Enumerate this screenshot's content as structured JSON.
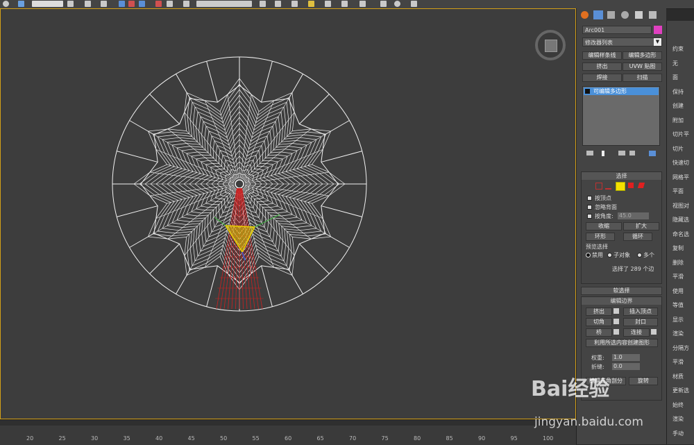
{
  "command_panel": {
    "object_name": "Arc001",
    "modifier_list": "修改器列表",
    "quick_buttons": [
      "编辑样条线",
      "编辑多边形",
      "挤出",
      "UVW 贴图",
      "焊接",
      "扫描"
    ],
    "stack_item": "可编辑多边形",
    "selection": {
      "title": "选择",
      "by_vertex": "按顶点",
      "ignore_backface": "忽略背面",
      "by_angle": "按角度:",
      "angle_value": "45.0",
      "shrink": "收缩",
      "grow": "扩大",
      "ring": "环形",
      "loop": "循环",
      "preview_title": "预览选择",
      "preview_options": [
        "禁用",
        "子对象",
        "多个"
      ],
      "status": "选择了 289 个边"
    },
    "soft_selection": "软选择",
    "edit_edges": {
      "title": "编辑边界",
      "extrude": "挤出",
      "insert_vertex": "插入顶点",
      "chamfer": "切角",
      "cap": "封口",
      "bridge": "桥",
      "connect": "连接",
      "create_shape": "利用所选内容创建图形",
      "weight_label": "权重:",
      "weight_value": "1.0",
      "crease_label": "折缝:",
      "crease_value": "0.0",
      "edit_tri": "编辑三角剖分",
      "turn": "旋转"
    }
  },
  "right_panel": {
    "items": [
      "约束",
      "无",
      "面",
      "保持",
      "创建",
      "附加",
      "切片平",
      "切片",
      "快速切",
      "网格平",
      "平面",
      "视图对",
      "隐藏选",
      "命名选",
      "复制",
      "删除",
      "平滑",
      "使用",
      "等值",
      "显示",
      "渲染",
      "分隔方",
      "平滑",
      "材质",
      "更新选",
      "始终",
      "渲染",
      "手动"
    ]
  },
  "timeline": {
    "ticks": [
      "20",
      "25",
      "30",
      "35",
      "40",
      "45",
      "50",
      "55",
      "60",
      "65",
      "70",
      "75",
      "80",
      "85",
      "90",
      "95",
      "100"
    ]
  },
  "watermark": {
    "brand": "Bai经验",
    "url": "jingyan.baidu.com"
  },
  "colors": {
    "selection_frame": "#d4a017",
    "object_color": "#e040c0",
    "selected_edges": "#cc2020",
    "gizmo": "#e8d000"
  }
}
